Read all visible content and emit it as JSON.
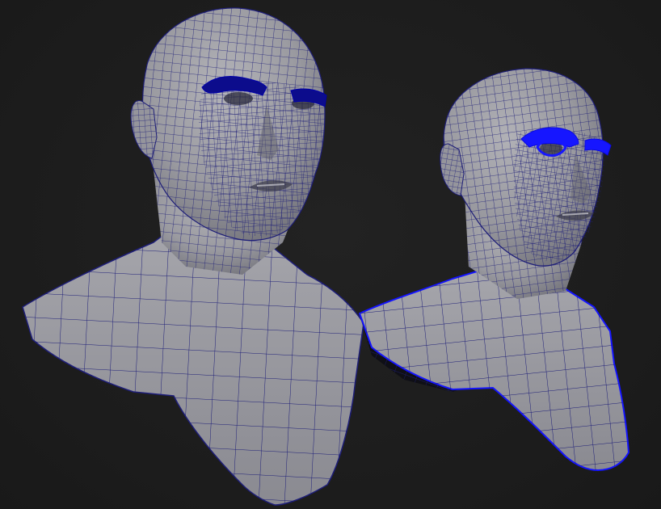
{
  "scene": {
    "background_color": "#1d1d1d",
    "mesh_fill_color": "#8c8c93",
    "wire_color": "#1e1e78",
    "selection_color": "#1414ff",
    "models": [
      {
        "name": "bust-front-three-quarter",
        "selected_feature": "eyebrows"
      },
      {
        "name": "bust-side-three-quarter",
        "selected_feature": "eyebrows"
      }
    ]
  }
}
